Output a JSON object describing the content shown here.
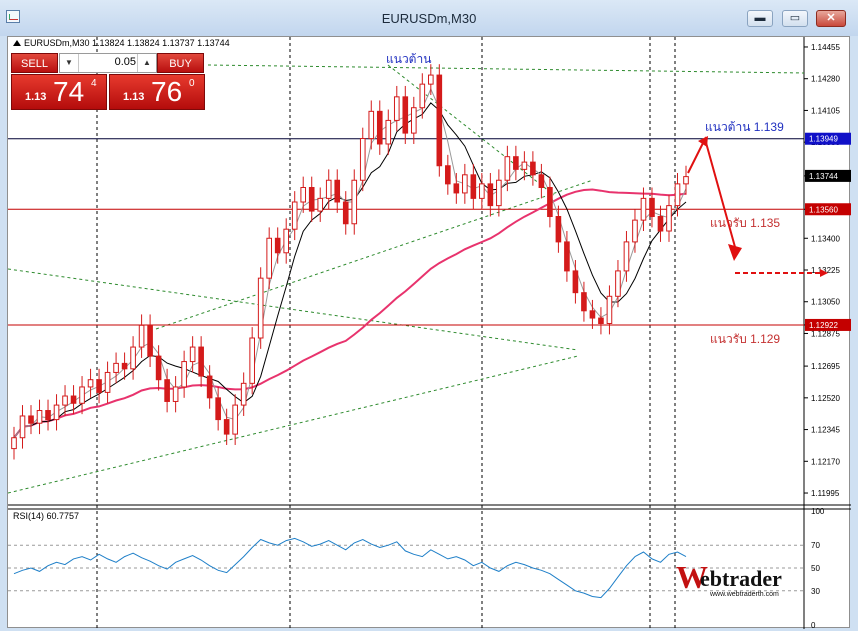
{
  "window": {
    "title": "EURUSDm,M30",
    "controls": {
      "minimize": "▬",
      "maximize": "▭",
      "close": "✕"
    },
    "icon": "chart-window-icon"
  },
  "chart_header": {
    "label": "EURUSDm,M30  1.13824 1.13824 1.13737 1.13744"
  },
  "trade_panel": {
    "sell_label": "SELL",
    "buy_label": "BUY",
    "lot": "0.05",
    "sell_price": {
      "prefix": "1.13",
      "big": "74",
      "sup": "4"
    },
    "buy_price": {
      "prefix": "1.13",
      "big": "76",
      "sup": "0"
    }
  },
  "annotations": {
    "top_resistance": "แนวต้าน",
    "resistance": "แนวต้าน 1.139",
    "support_1": "แนวรับ 1.135",
    "support_2": "แนวรับ 1.129"
  },
  "rsi": {
    "label": "RSI(14) 60.7757"
  },
  "watermark": {
    "brand_w": "W",
    "brand_text": "ebtrader",
    "url": "www.webtraderth.com"
  },
  "colors": {
    "candle": "#d41b1b",
    "support_line": "#c40000",
    "resistance_line": "#000033",
    "long_ma": "#e8336d",
    "short_ma": "#000000",
    "trend_lines": "#2e8b2e",
    "rsi_line": "#1e7fc8",
    "arrow": "#e01010"
  },
  "chart_data": {
    "type": "candlestick",
    "symbol": "EURUSDm",
    "timeframe": "M30",
    "y_ticks": [
      "1.14455",
      "1.14280",
      "1.14105",
      "1.13930",
      "1.13744",
      "1.13560",
      "1.13400",
      "1.13225",
      "1.13050",
      "1.12922",
      "1.12875",
      "1.12695",
      "1.12520",
      "1.12345",
      "1.12170",
      "1.11995"
    ],
    "ylim": [
      1.1194,
      1.1451
    ],
    "horizontal_levels": [
      {
        "value": 1.13949,
        "label": "1.13949",
        "kind": "resistance"
      },
      {
        "value": 1.13744,
        "label": "1.13744",
        "kind": "current"
      },
      {
        "value": 1.1356,
        "label": "1.13560",
        "kind": "support"
      },
      {
        "value": 1.12922,
        "label": "1.12922",
        "kind": "support"
      }
    ],
    "close_series": [
      1.123,
      1.1242,
      1.1238,
      1.1245,
      1.124,
      1.1248,
      1.1253,
      1.1249,
      1.1258,
      1.1262,
      1.1255,
      1.1266,
      1.1271,
      1.1268,
      1.128,
      1.1292,
      1.1275,
      1.1262,
      1.125,
      1.1258,
      1.1272,
      1.128,
      1.1264,
      1.1252,
      1.124,
      1.1232,
      1.1248,
      1.126,
      1.1285,
      1.1318,
      1.134,
      1.1332,
      1.1345,
      1.136,
      1.1368,
      1.1355,
      1.1362,
      1.1372,
      1.136,
      1.1348,
      1.1372,
      1.1395,
      1.141,
      1.1392,
      1.1405,
      1.1418,
      1.1398,
      1.1412,
      1.1425,
      1.143,
      1.138,
      1.137,
      1.1365,
      1.1375,
      1.1362,
      1.137,
      1.1358,
      1.1372,
      1.1385,
      1.1378,
      1.1382,
      1.1375,
      1.1368,
      1.1352,
      1.1338,
      1.1322,
      1.131,
      1.13,
      1.1296,
      1.1293,
      1.1308,
      1.1322,
      1.1338,
      1.135,
      1.1362,
      1.1352,
      1.1344,
      1.1358,
      1.137,
      1.1374
    ],
    "rsi_series": [
      45,
      48,
      50,
      47,
      52,
      55,
      53,
      58,
      60,
      57,
      62,
      58,
      55,
      60,
      63,
      59,
      56,
      52,
      49,
      55,
      58,
      61,
      57,
      52,
      48,
      46,
      53,
      60,
      68,
      75,
      72,
      70,
      74,
      76,
      73,
      69,
      71,
      74,
      70,
      66,
      72,
      75,
      71,
      68,
      70,
      73,
      65,
      62,
      60,
      66,
      62,
      58,
      60,
      57,
      52,
      55,
      50,
      47,
      52,
      55,
      53,
      50,
      48,
      45,
      40,
      35,
      30,
      28,
      25,
      24,
      32,
      42,
      52,
      60,
      64,
      58,
      55,
      62,
      64,
      60
    ],
    "rsi_levels": [
      100,
      70,
      50,
      30,
      0
    ],
    "rsi_ylim": [
      0,
      100
    ]
  }
}
